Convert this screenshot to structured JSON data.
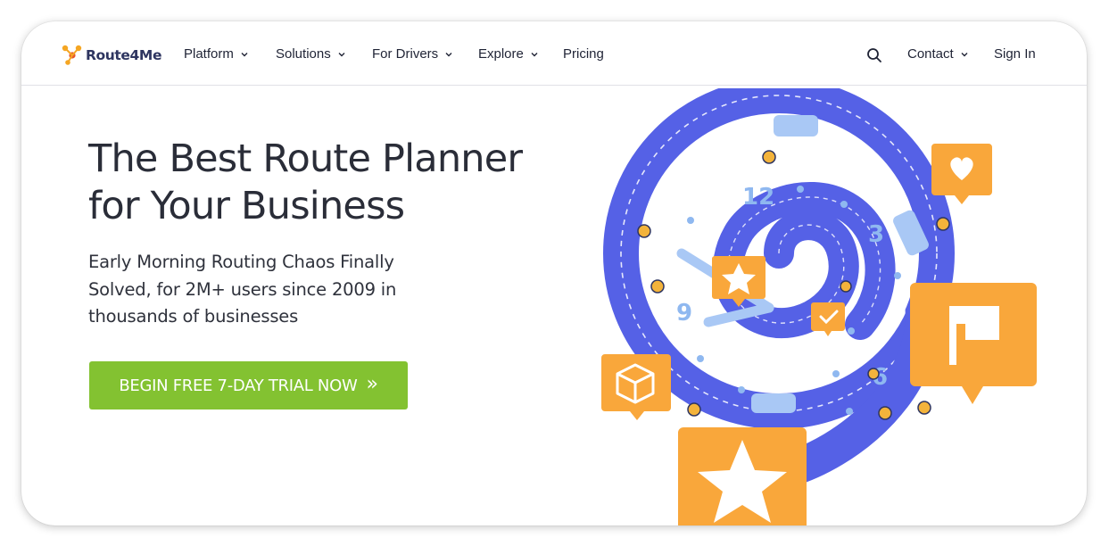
{
  "header": {
    "brand": "Route4Me",
    "nav": [
      {
        "label": "Platform"
      },
      {
        "label": "Solutions"
      },
      {
        "label": "For Drivers"
      },
      {
        "label": "Explore"
      },
      {
        "label": "Pricing"
      }
    ],
    "contact_label": "Contact",
    "signin_label": "Sign In"
  },
  "hero": {
    "headline_line1": "The Best Route Planner",
    "headline_line2": "for Your Business",
    "sub_line1": "Early Morning Routing Chaos Finally",
    "sub_line2": "Solved, for 2M+ users since 2009 in",
    "sub_line3": "thousands of businesses",
    "cta_label": "BEGIN FREE 7-DAY TRIAL NOW",
    "cta_arrows": "»"
  },
  "illustration": {
    "clock_numbers": [
      "12",
      "3",
      "6",
      "9"
    ],
    "badge_icons": [
      "heart-icon",
      "flag-icon",
      "star-icon",
      "box-icon",
      "check-icon"
    ]
  },
  "colors": {
    "accent_green": "#83c231",
    "spiral_blue": "#5561e6",
    "badge_orange": "#f9a73b",
    "brand_navy": "#2e3560"
  }
}
